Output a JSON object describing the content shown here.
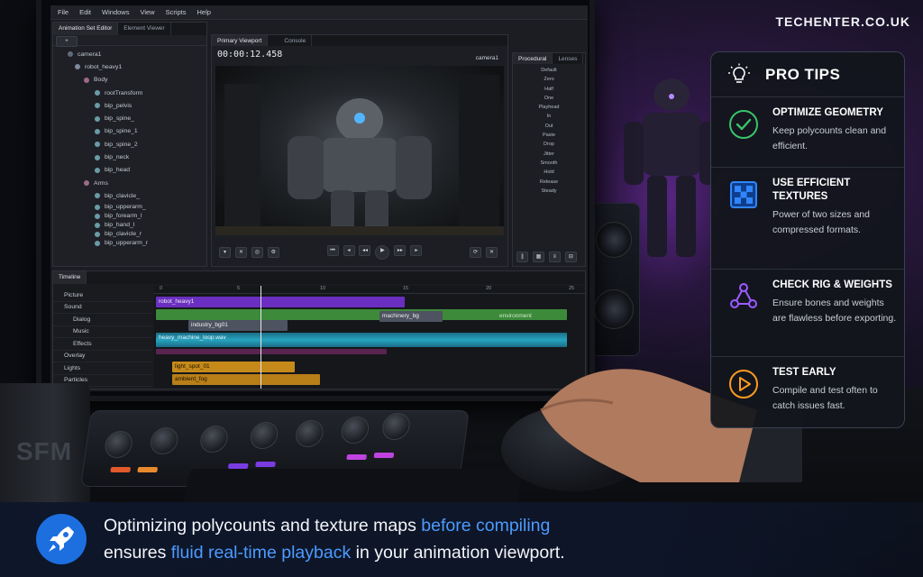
{
  "brand": "TECHENTER.CO.UK",
  "sfm": {
    "menu": [
      "File",
      "Edit",
      "Windows",
      "View",
      "Scripts",
      "Help"
    ],
    "left_tabs": [
      "Animation Set Editor",
      "Element Viewer"
    ],
    "tree": [
      "camera1",
      "robot_heavy1",
      "Body",
      "rootTransform",
      "bip_pelvis",
      "bip_spine_",
      "bip_spine_1",
      "bip_spine_2",
      "bip_neck",
      "bip_head",
      "Arms",
      "bip_clavicle_",
      "bip_upperarm_",
      "bip_forearm_l",
      "bip_hand_l",
      "bip_clavicle_r",
      "bip_upperarm_r"
    ],
    "viewport_tabs": [
      "Primary Viewport",
      "Console"
    ],
    "timecode": "00:00:12.458",
    "camera_label": "camera1",
    "procedural_tabs": [
      "Procedural",
      "Lenses"
    ],
    "procedural_items": [
      "Default",
      "Zero",
      "Half",
      "One",
      "Playhead",
      "In",
      "Out",
      "Paste",
      "Drop",
      "Jitter",
      "Smooth",
      "Hold",
      "Release",
      "Steady"
    ],
    "timeline_tab": "Timeline",
    "tracks": [
      "Picture",
      "Sound",
      "Dialog",
      "Music",
      "Effects",
      "Overlay",
      "Lights",
      "Particles"
    ],
    "ruler_marks": [
      "0",
      "5",
      "10",
      "15",
      "20",
      "25"
    ],
    "clips": {
      "picture": "robot_heavy1",
      "sound_a": "industry_bg01",
      "sound_b": "machinery_bg",
      "sound_c": "environment",
      "effects": "heavy_machine_loop.wav",
      "light": "light_spot_01",
      "particles": "ambient_fog"
    }
  },
  "mug_label": "SFM",
  "tips": {
    "title": "PRO TIPS",
    "items": [
      {
        "icon": "check-circle-icon",
        "title": "OPTIMIZE GEOMETRY",
        "body": "Keep polycounts clean and efficient.",
        "color": "#39c46a"
      },
      {
        "icon": "checkerboard-icon",
        "title": "USE EFFICIENT TEXTURES",
        "body": "Power of two sizes and compressed formats.",
        "color": "#2f86ff"
      },
      {
        "icon": "rig-nodes-icon",
        "title": "CHECK RIG & WEIGHTS",
        "body": "Ensure bones and weights are flawless before exporting.",
        "color": "#9b5cff"
      },
      {
        "icon": "play-circle-icon",
        "title": "TEST EARLY",
        "body": "Compile and test often to catch issues fast.",
        "color": "#ff9a1f"
      }
    ]
  },
  "banner": {
    "part1": "Optimizing polycounts and texture maps ",
    "highlight1": "before compiling",
    "part2": "ensures ",
    "highlight2": "fluid real-time playback",
    "part3": " in your animation viewport.",
    "accent": "#4c9bff"
  }
}
